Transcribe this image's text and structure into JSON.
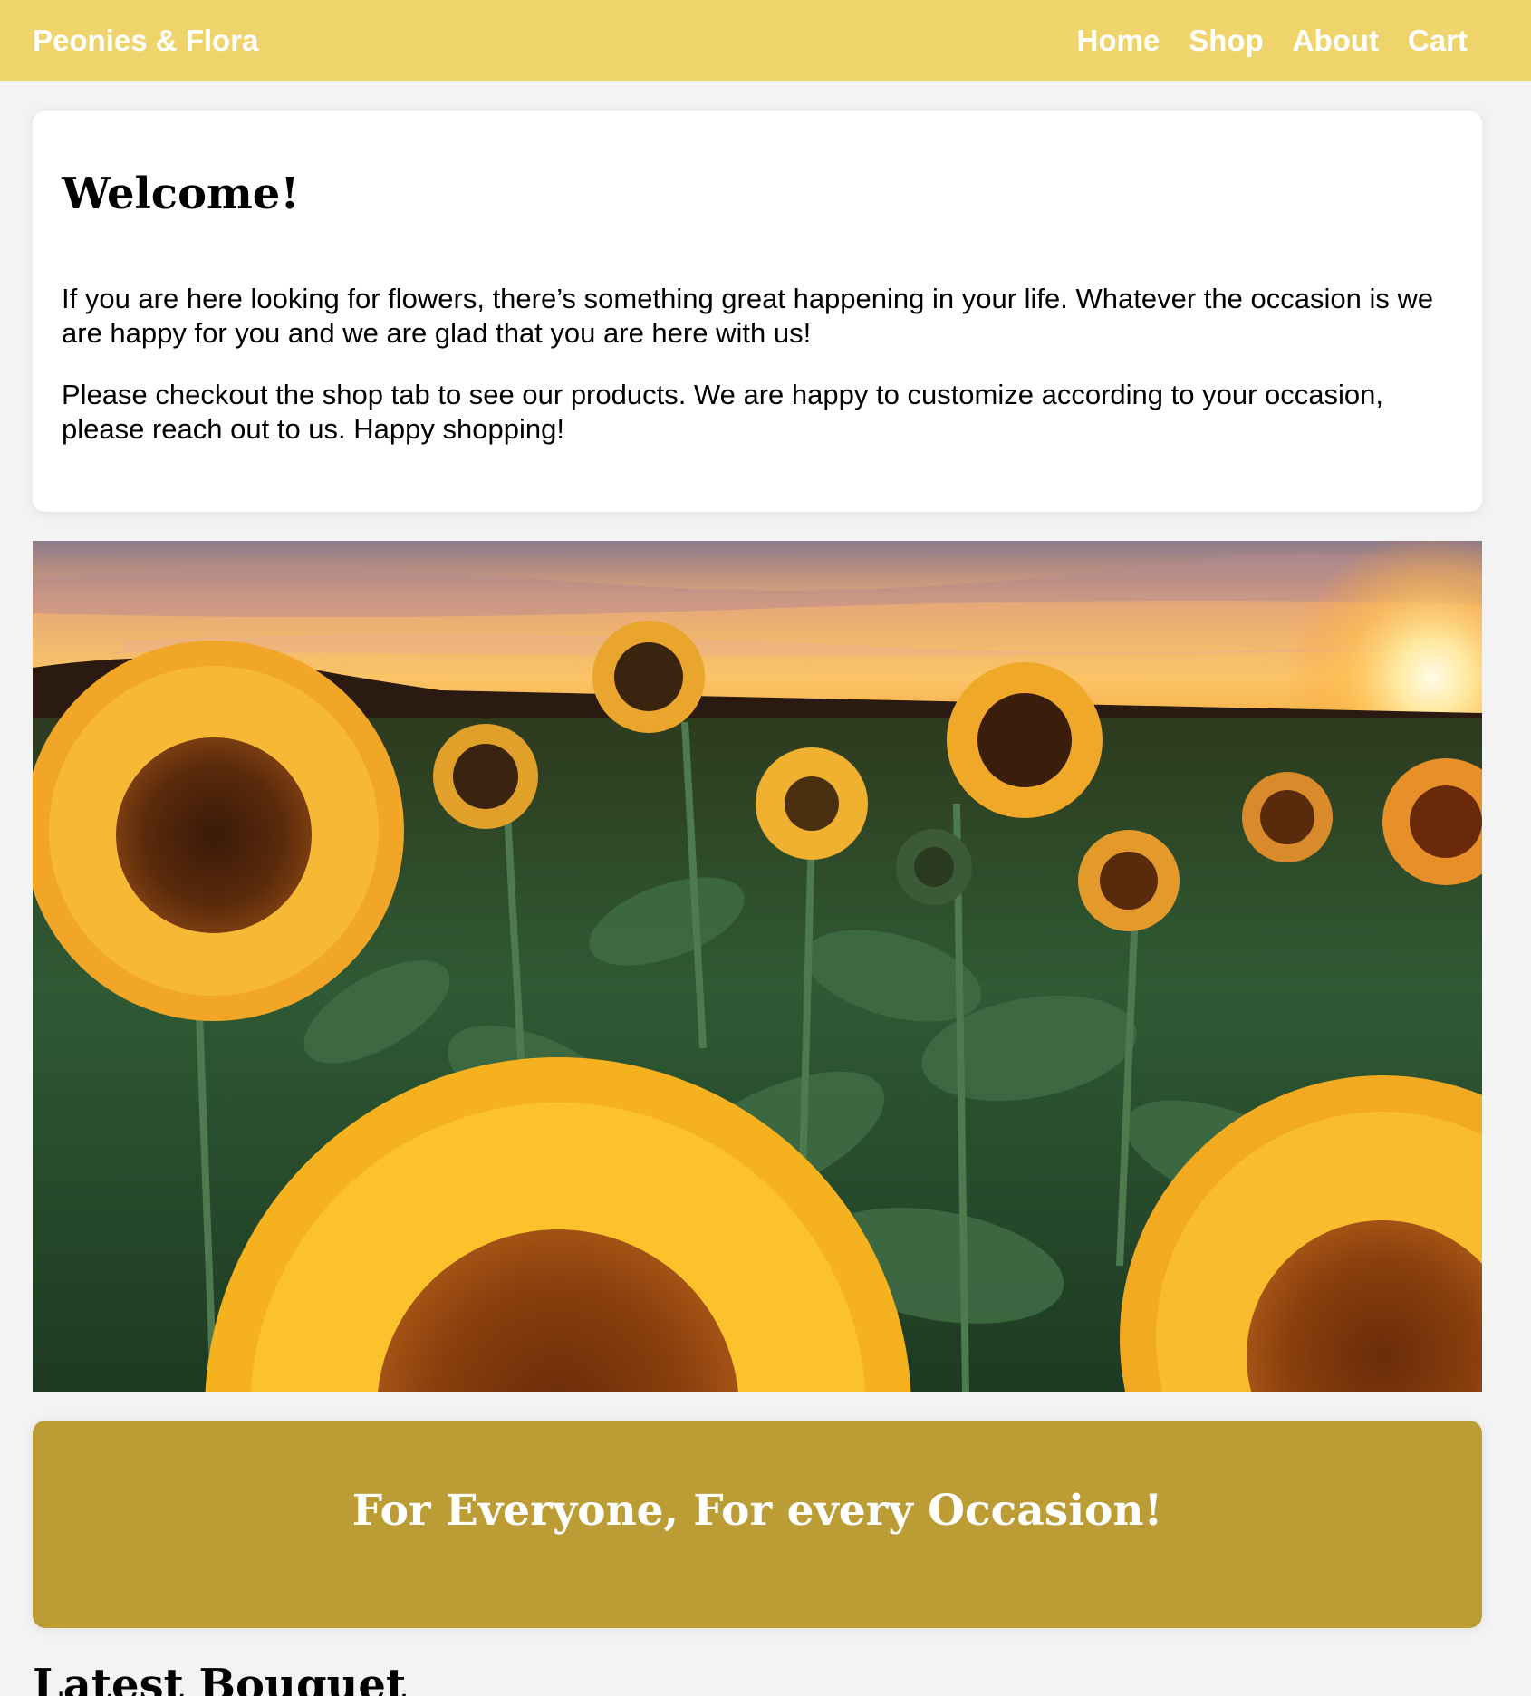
{
  "header": {
    "brand": "Peonies & Flora",
    "nav": [
      "Home",
      "Shop",
      "About",
      "Cart"
    ]
  },
  "welcome": {
    "title": "Welcome!",
    "paragraph1": "If you are here looking for flowers, there’s something great happening in your life. Whatever the occasion is we are happy for you and we are glad that you are here with us!",
    "paragraph2": "Please checkout the shop tab to see our products. We are happy to customize according to your occasion, please reach out to us. Happy shopping!"
  },
  "hero": {
    "image": "sunflower-field-at-sunset"
  },
  "banner": {
    "text": "For Everyone, For every Occasion!"
  },
  "latest": {
    "title": "Latest Bouquet"
  },
  "colors": {
    "header_bg": "#efd46c",
    "banner_bg": "#bb9c35",
    "page_bg": "#f3f3f3"
  }
}
